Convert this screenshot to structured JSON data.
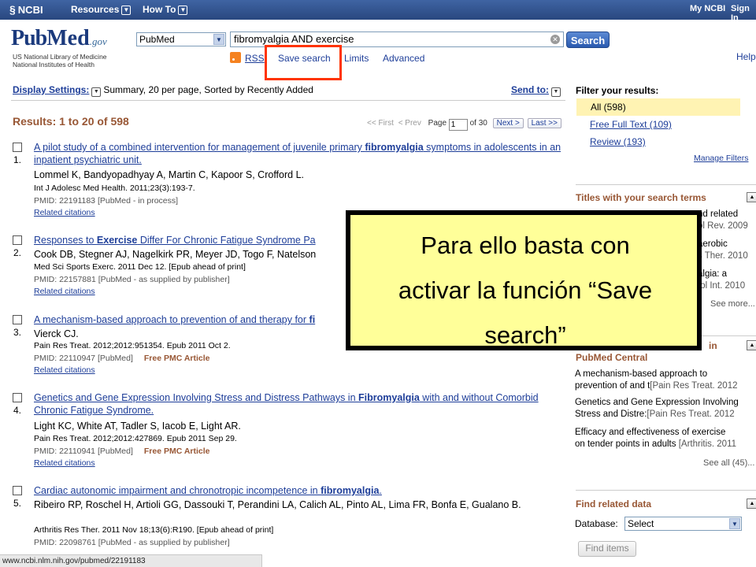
{
  "ncbi_bar": {
    "logo": "NCBI",
    "menu": [
      "Resources",
      "How To"
    ],
    "my_ncbi": "My NCBI",
    "sign_in": "Sign In"
  },
  "header": {
    "logo_pub": "Pub",
    "logo_med": "Med",
    "logo_gov": ".gov",
    "logo_sub1": "US National Library of Medicine",
    "logo_sub2": "National Institutes of Health",
    "database_value": "PubMed",
    "search_value": "fibromyalgia AND exercise",
    "search_label": "Search",
    "links": {
      "rss": "RSS",
      "save_search": "Save search",
      "limits": "Limits",
      "advanced": "Advanced"
    },
    "help": "Help"
  },
  "display": {
    "label": "Display Settings:",
    "value": "Summary, 20 per page, Sorted by Recently Added",
    "send_to": "Send to:"
  },
  "results_header": {
    "count_text": "Results: 1 to 20 of 598",
    "first": "<< First",
    "prev": "< Prev",
    "page_label": "Page",
    "page_value": "1",
    "of_text": "of 30",
    "next": "Next >",
    "last": "Last >>"
  },
  "results": [
    {
      "num": "1.",
      "title_html": "A pilot study of a combined intervention for management of juvenile primary <b>fibromyalgia</b> symptoms in adolescents in an inpatient psychiatric unit.",
      "authors": "Lommel K, Bandyopadhyay A, Martin C, Kapoor S, Crofford L.",
      "journal": "Int J Adolesc Med Health. 2011;23(3):193-7.",
      "pmid": "PMID: 22191183 [PubMed - in process]",
      "free": "",
      "related": "Related citations"
    },
    {
      "num": "2.",
      "title_html": "Responses to <b>Exercise</b> Differ For Chronic Fatigue Syndrome Pa",
      "authors": "Cook DB, Stegner AJ, Nagelkirk PR, Meyer JD, Togo F, Natelson",
      "journal": "Med Sci Sports Exerc. 2011 Dec 12. [Epub ahead of print]",
      "pmid": "PMID: 22157881 [PubMed - as supplied by publisher]",
      "free": "",
      "related": "Related citations"
    },
    {
      "num": "3.",
      "title_html": "A mechanism-based approach to prevention of and therapy for <b>fi</b>",
      "authors": "Vierck CJ.",
      "journal": "Pain Res Treat. 2012;2012:951354. Epub 2011 Oct 2.",
      "pmid": "PMID: 22110947 [PubMed]",
      "free": "Free PMC Article",
      "related": "Related citations"
    },
    {
      "num": "4.",
      "title_html": "Genetics and Gene Expression Involving Stress and Distress Pathways in <b>Fibromyalgia</b> with and without Comorbid Chronic Fatigue Syndrome.",
      "authors": "Light KC, White AT, Tadler S, Iacob E, Light AR.",
      "journal": "Pain Res Treat. 2012;2012:427869. Epub 2011 Sep 29.",
      "pmid": "PMID: 22110941 [PubMed]",
      "free": "Free PMC Article",
      "related": "Related citations"
    },
    {
      "num": "5.",
      "title_html": "Cardiac autonomic impairment and chronotropic incompetence in <b>fibromyalgia</b>.",
      "authors": "Ribeiro RP, Roschel H, Artioli GG, Dassouki T, Perandini LA, Calich AL, Pinto AL, Lima FR, Bonfa E, Gualano B.",
      "journal": "Arthritis Res Ther. 2011 Nov 18;13(6):R190. [Epub ahead of print]",
      "pmid": "PMID: 22098761 [PubMed - as supplied by publisher]",
      "free": "",
      "related": ""
    }
  ],
  "right": {
    "filter_title": "Filter your results:",
    "filter_all": "All (598)",
    "filter_free": "Free Full Text (109)",
    "filter_review": "Review (193)",
    "manage_filters": "Manage Filters",
    "titles_header": "Titles with your search terms",
    "titles_lines": [
      "nd related",
      "ol Rev. 2009",
      "aerobic",
      "s Ther. 2010",
      "algia: a",
      "tol Int. 2010"
    ],
    "see_more": "See more...",
    "pmc_header_tail": "in",
    "pmc_title": "PubMed Central",
    "pmc_items": [
      {
        "l1": "A mechanism-based approach to",
        "l2a": "prevention of and t",
        "l2b": "[Pain Res Treat. 2012"
      },
      {
        "l1": "Genetics and Gene Expression Involving",
        "l2a": "Stress and Distre:",
        "l2b": "[Pain Res Treat. 2012"
      },
      {
        "l1": "Efficacy and effectiveness of exercise",
        "l2a": "on tender points in adults",
        "l2b": "[Arthritis. 2011"
      }
    ],
    "see_all": "See all (45)...",
    "find_related_title": "Find related data",
    "database_label": "Database:",
    "database_value": "Select",
    "find_items": "Find items"
  },
  "status_bar": "www.ncbi.nlm.nih.gov/pubmed/22191183",
  "callout": {
    "line1": "Para ello basta con",
    "line2": "activar la función “Save",
    "line3": "search”"
  },
  "colors": {
    "brand": "#2e508f",
    "accent_brown": "#985735",
    "link": "#1e3e99",
    "highlight": "#ff3300",
    "callout_bg": "#ffff99"
  }
}
